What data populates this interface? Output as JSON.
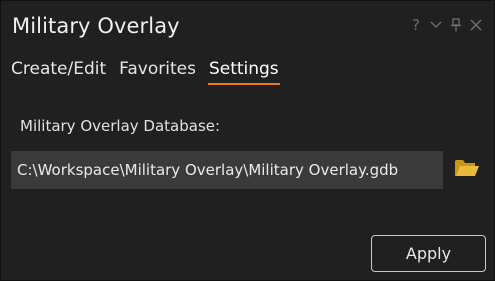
{
  "panel": {
    "title": "Military Overlay"
  },
  "title_controls": {
    "help": "?",
    "menu_icon": "chevron-down-icon",
    "pin_icon": "pin-icon",
    "close_icon": "close-icon"
  },
  "tabs": [
    {
      "label": "Create/Edit",
      "active": false
    },
    {
      "label": "Favorites",
      "active": false
    },
    {
      "label": "Settings",
      "active": true
    }
  ],
  "settings": {
    "database_label": "Military Overlay Database:",
    "database_path": "C:\\Workspace\\Military Overlay\\Military Overlay.gdb",
    "browse_icon": "folder-icon",
    "apply_label": "Apply"
  },
  "colors": {
    "accent": "#e7782b",
    "folder": "#e8b93a",
    "background": "#202020",
    "field_background": "#3a3a3a"
  }
}
